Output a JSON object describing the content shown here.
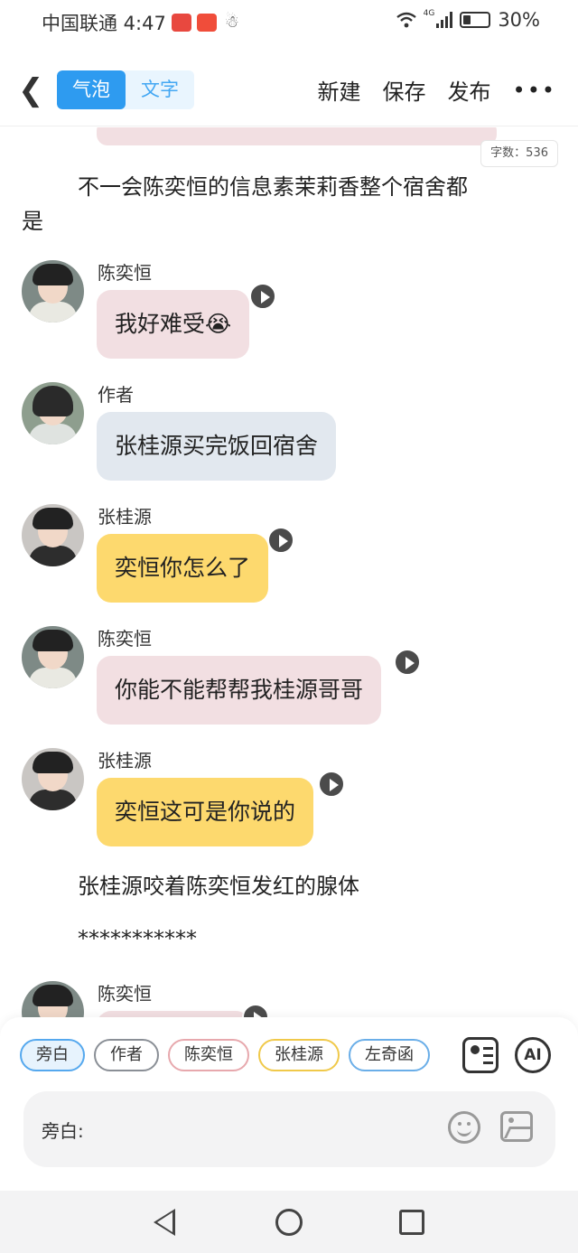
{
  "status_bar": {
    "carrier_time": "中国联通 4:47",
    "network": "4G",
    "battery": "30%"
  },
  "header": {
    "tabs": [
      {
        "label": "气泡",
        "active": true
      },
      {
        "label": "文字",
        "active": false
      }
    ],
    "actions": {
      "new_label": "新建",
      "save_label": "保存",
      "publish_label": "发布",
      "more_label": "•••"
    }
  },
  "word_count": "字数：536",
  "narration": {
    "line1a": "不一会陈奕恒的信息素茉莉香整个宿舍都",
    "line1b": "是",
    "line2": "张桂源咬着陈奕恒发红的腺体",
    "line3": "***********"
  },
  "messages": [
    {
      "sender": "陈奕恒",
      "text": "我好难受😭",
      "color": "pink"
    },
    {
      "sender": "作者",
      "text": "张桂源买完饭回宿舍",
      "color": "gray"
    },
    {
      "sender": "张桂源",
      "text": "奕恒你怎么了",
      "color": "yellow"
    },
    {
      "sender": "陈奕恒",
      "text": "你能不能帮帮我桂源哥哥",
      "color": "pink"
    },
    {
      "sender": "张桂源",
      "text": "奕恒这可是你说的",
      "color": "yellow"
    },
    {
      "sender": "陈奕恒",
      "text": "",
      "color": "pink"
    }
  ],
  "role_chips": [
    "旁白",
    "作者",
    "陈奕恒",
    "张桂源",
    "左奇函"
  ],
  "input": {
    "label": "旁白:"
  },
  "ai_label": "AI",
  "colors": {
    "accent": "#2e9bf0",
    "pink_bubble": "#f2dfe2",
    "gray_bubble": "#e2e8ef",
    "yellow_bubble": "#fdd96e"
  }
}
